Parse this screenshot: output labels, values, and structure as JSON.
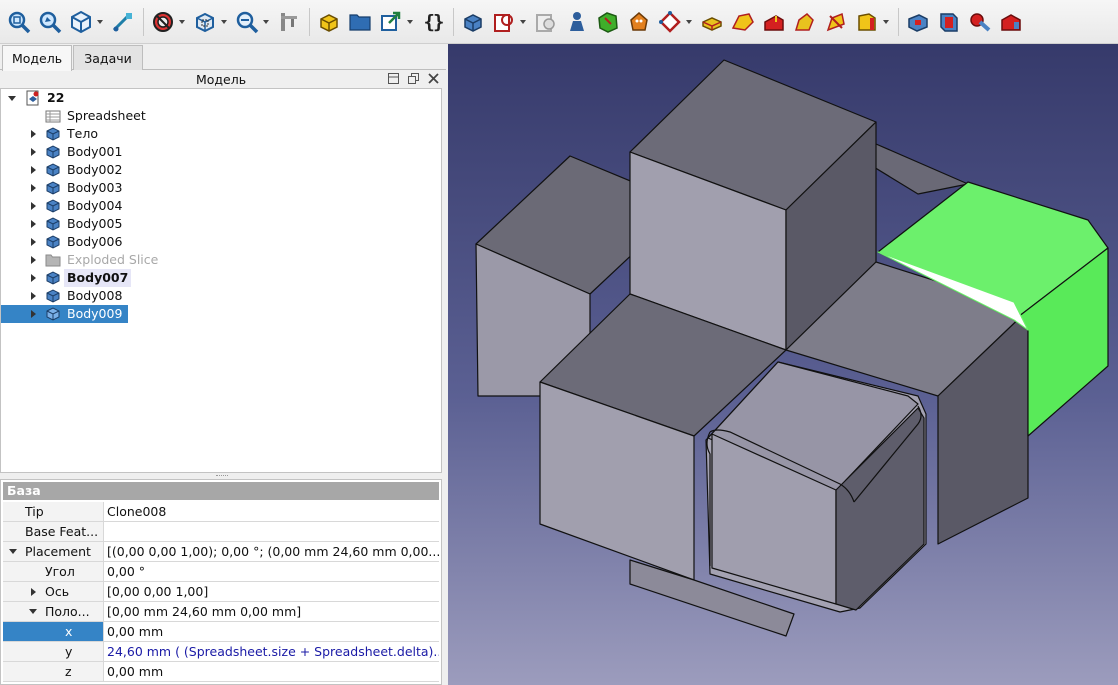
{
  "tabs": [
    {
      "label": "Модель"
    },
    {
      "label": "Задачи"
    }
  ],
  "tree_title": "Модель",
  "tree": [
    {
      "label": "22"
    },
    {
      "label": "Spreadsheet"
    },
    {
      "label": "Тело"
    },
    {
      "label": "Body001"
    },
    {
      "label": "Body002"
    },
    {
      "label": "Body003"
    },
    {
      "label": "Body004"
    },
    {
      "label": "Body005"
    },
    {
      "label": "Body006"
    },
    {
      "label": "Exploded Slice"
    },
    {
      "label": "Body007"
    },
    {
      "label": "Body008"
    },
    {
      "label": "Body009"
    }
  ],
  "properties": {
    "group": "База",
    "rows": [
      {
        "name": "Tip",
        "value": "Clone008"
      },
      {
        "name": "Base Feat...",
        "value": ""
      },
      {
        "name": "Placement",
        "value": "[(0,00 0,00 1,00); 0,00 °; (0,00 mm  24,60 mm  0,00..."
      },
      {
        "name": "Угол",
        "value": "0,00 °"
      },
      {
        "name": "Ось",
        "value": "[0,00 0,00 1,00]"
      },
      {
        "name": "Поло...",
        "value": "[0,00 mm  24,60 mm  0,00 mm]"
      },
      {
        "name": "x",
        "value": "0,00 mm"
      },
      {
        "name": "y",
        "value": "24,60 mm  ( (Spreadsheet.size + Spreadsheet.delta)..."
      },
      {
        "name": "z",
        "value": "0,00 mm"
      }
    ]
  },
  "toolbar_icons": [
    "fit-all-icon",
    "fit-selection-icon",
    "std-views-icon",
    "measure-icon",
    "draw-style-icon",
    "bounding-box-icon",
    "zoom-icon",
    "sketcher-icon",
    "part-icon",
    "folder-icon",
    "link-icon",
    "macro-icon",
    "body-icon",
    "attachment-icon",
    "check-geometry-icon",
    "figure-icon",
    "shape-binder-icon",
    "clone-icon",
    "sketch-icon",
    "pad-icon",
    "pocket-icon",
    "revolve-icon",
    "loft-icon",
    "groove-icon",
    "fillet-icon",
    "chamfer-icon",
    "mirror-icon",
    "pattern-icon",
    "boolean-icon"
  ],
  "colors": {
    "selection": "#3584c6",
    "highlight": "#66ff66",
    "group_header": "#a7a7a7"
  }
}
